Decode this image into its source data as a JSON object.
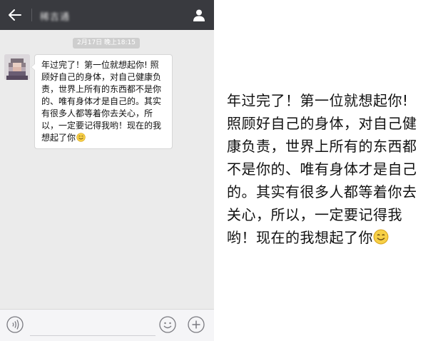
{
  "header": {
    "back_icon": "arrow-left-icon",
    "contact_name": "稀吉通",
    "profile_icon": "person-icon"
  },
  "chat": {
    "timestamp": "2月17日 晚上18:15",
    "message": {
      "text": "年过完了！第一位就想起你! 照顾好自己的身体，对自己健康负责，世界上所有的东西都不是你的、唯有身体才是自己的。其实有很多人都等着你去关心，所以，一定要记得我哟！现在的我想起了你",
      "emoji": "smiley-icon"
    }
  },
  "input_bar": {
    "voice_icon": "voice-icon",
    "input_value": "",
    "emoji_icon": "emoji-icon",
    "plus_icon": "plus-icon"
  },
  "enlarged": {
    "text": "年过完了！第一位就想起你! 照顾好自己的身体，对自己健康负责，世界上所有的东西都不是你的、唯有身体才是自己的。其实有很多人都等着你去关心，所以，一定要记得我哟！现在的我想起了你",
    "emoji": "smiley-icon"
  },
  "colors": {
    "header_bg": "#393a3f",
    "chat_bg": "#ebebeb",
    "bubble_bg": "#ffffff",
    "timestamp_bg": "#cecece"
  }
}
